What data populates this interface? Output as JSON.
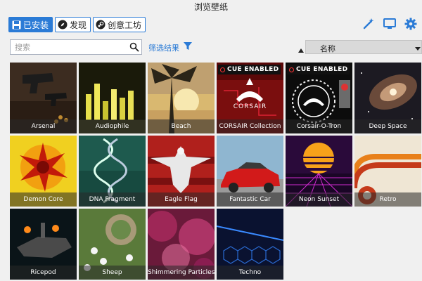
{
  "window": {
    "title": "浏览壁纸"
  },
  "tabs": [
    {
      "label": "已安装",
      "icon": "save-icon",
      "active": true
    },
    {
      "label": "发现",
      "icon": "compass-icon",
      "active": false
    },
    {
      "label": "创意工坊",
      "icon": "steam-icon",
      "active": false
    }
  ],
  "tools": [
    "wand-icon",
    "monitor-icon",
    "gear-icon"
  ],
  "search": {
    "placeholder": "搜索",
    "value": ""
  },
  "filter": {
    "label": "筛选结果"
  },
  "sort": {
    "value": "名称"
  },
  "cue_badge": "CUE ENABLED",
  "corsair_brand": "CORSAIR",
  "accent_color": "#2b7bd6",
  "wallpapers": [
    {
      "title": "Arsenal"
    },
    {
      "title": "Audiophile"
    },
    {
      "title": "Beach"
    },
    {
      "title": "CORSAIR Collection",
      "cue": true
    },
    {
      "title": "Corsair-O-Tron",
      "cue": true
    },
    {
      "title": "Deep Space",
      "selected": true
    },
    {
      "title": "Demon Core"
    },
    {
      "title": "DNA Fragment"
    },
    {
      "title": "Eagle Flag"
    },
    {
      "title": "Fantastic Car"
    },
    {
      "title": "Neon Sunset"
    },
    {
      "title": "Retro"
    },
    {
      "title": "Ricepod"
    },
    {
      "title": "Sheep"
    },
    {
      "title": "Shimmering Particles"
    },
    {
      "title": "Techno"
    }
  ]
}
